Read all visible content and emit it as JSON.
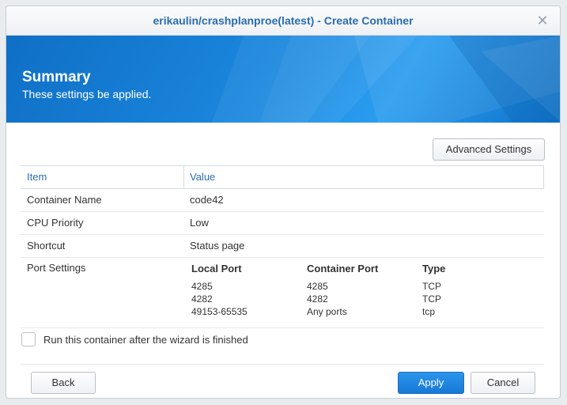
{
  "window": {
    "title": "erikaulin/crashplanproe(latest) - Create Container",
    "close_icon": "close-icon"
  },
  "banner": {
    "title": "Summary",
    "subtitle": "These settings be applied."
  },
  "toolbar": {
    "advanced_settings_label": "Advanced Settings"
  },
  "table": {
    "columns": [
      "Item",
      "Value"
    ],
    "rows": [
      {
        "item": "Container Name",
        "value": "code42"
      },
      {
        "item": "CPU Priority",
        "value": "Low"
      },
      {
        "item": "Shortcut",
        "value": "Status page"
      }
    ],
    "port_settings": {
      "label": "Port Settings",
      "headers": [
        "Local Port",
        "Container Port",
        "Type"
      ],
      "rows": [
        {
          "local": "4285",
          "container": "4285",
          "type": "TCP"
        },
        {
          "local": "4282",
          "container": "4282",
          "type": "TCP"
        },
        {
          "local": "49153-65535",
          "container": "Any ports",
          "type": "tcp"
        }
      ]
    }
  },
  "options": {
    "run_after_label": "Run this container after the wizard is finished",
    "run_after_checked": false
  },
  "footer": {
    "back_label": "Back",
    "apply_label": "Apply",
    "cancel_label": "Cancel"
  },
  "colors": {
    "accent": "#2a6db0",
    "banner_blue": "#1a86dc",
    "apply_blue": "#1778d6"
  }
}
